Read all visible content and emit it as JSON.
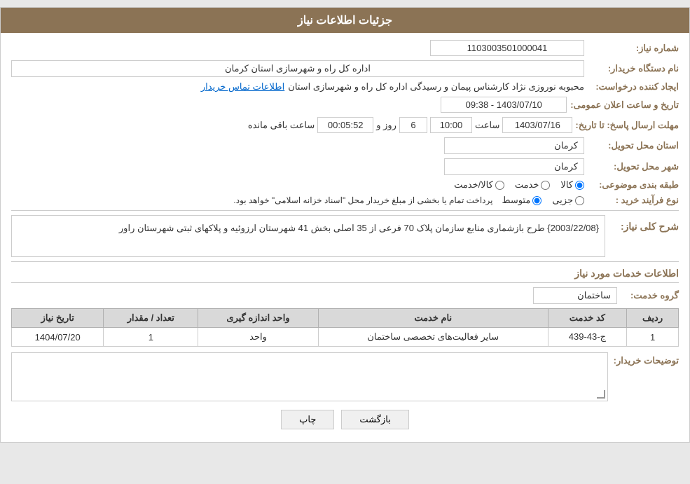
{
  "header": {
    "title": "جزئیات اطلاعات نیاز"
  },
  "fields": {
    "request_number_label": "شماره نیاز:",
    "request_number_value": "1103003501000041",
    "buyer_org_label": "نام دستگاه خریدار:",
    "buyer_org_value": "اداره کل راه و شهرسازی استان کرمان",
    "creator_label": "ایجاد کننده درخواست:",
    "creator_value": "محبوبه نوروزی نژاد کارشناس پیمان و رسیدگی اداره کل راه و شهرسازی استان",
    "creator_link": "اطلاعات تماس خریدار",
    "announce_date_label": "تاریخ و ساعت اعلان عمومی:",
    "announce_date_value": "1403/07/10 - 09:38",
    "reply_deadline_label": "مهلت ارسال پاسخ: تا تاریخ:",
    "reply_date": "1403/07/16",
    "reply_time_label": "ساعت",
    "reply_time": "10:00",
    "remaining_days_label": "روز و",
    "remaining_days": "6",
    "remaining_time_label": "ساعت باقی مانده",
    "remaining_time": "00:05:52",
    "province_label": "استان محل تحویل:",
    "province_value": "کرمان",
    "city_label": "شهر محل تحویل:",
    "city_value": "کرمان",
    "category_label": "طبقه بندی موضوعی:",
    "cat_radio1": "کالا",
    "cat_radio2": "خدمت",
    "cat_radio3": "کالا/خدمت",
    "cat_selected": "کالا",
    "process_label": "نوع فرآیند خرید :",
    "proc_radio1": "جزیی",
    "proc_radio2": "متوسط",
    "proc_note": "پرداخت تمام یا بخشی از مبلغ خریدار محل \"اسناد خزانه اسلامی\" خواهد بود.",
    "description_label": "شرح کلی نیاز:",
    "description_value": "{2003/22/08} طرح بازشماری منابع سازمان پلاک 70 فرعی از 35 اصلی بخش 41 شهرستان ارزوئیه و پلاکهای ثبتی شهرستان راور",
    "services_title": "اطلاعات خدمات مورد نیاز",
    "group_label": "گروه خدمت:",
    "group_value": "ساختمان",
    "table": {
      "headers": [
        "ردیف",
        "کد خدمت",
        "نام خدمت",
        "واحد اندازه گیری",
        "تعداد / مقدار",
        "تاریخ نیاز"
      ],
      "rows": [
        [
          "1",
          "ج-43-439",
          "سایر فعالیت‌های تخصصی ساختمان",
          "واحد",
          "1",
          "1404/07/20"
        ]
      ]
    },
    "buyer_notes_label": "توضیحات خریدار:",
    "buyer_notes_value": "",
    "btn_print": "چاپ",
    "btn_back": "بازگشت"
  }
}
